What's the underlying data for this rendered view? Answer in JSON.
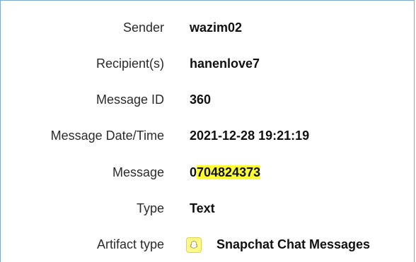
{
  "fields": {
    "sender": {
      "label": "Sender",
      "value": "wazim02"
    },
    "recipients": {
      "label": "Recipient(s)",
      "value": "hanenlove7"
    },
    "message_id": {
      "label": "Message ID",
      "value": "360"
    },
    "message_datetime": {
      "label": "Message Date/Time",
      "value": "2021-12-28 19:21:19"
    },
    "message": {
      "label": "Message",
      "value_prefix": "0",
      "value_highlight": "704824373"
    },
    "type": {
      "label": "Type",
      "value": "Text"
    },
    "artifact_type": {
      "label": "Artifact type",
      "value": "Snapchat Chat Messages",
      "icon": "snapchat-ghost-icon"
    }
  },
  "colors": {
    "highlight": "#ffff33",
    "border": "#7fa7d6"
  }
}
